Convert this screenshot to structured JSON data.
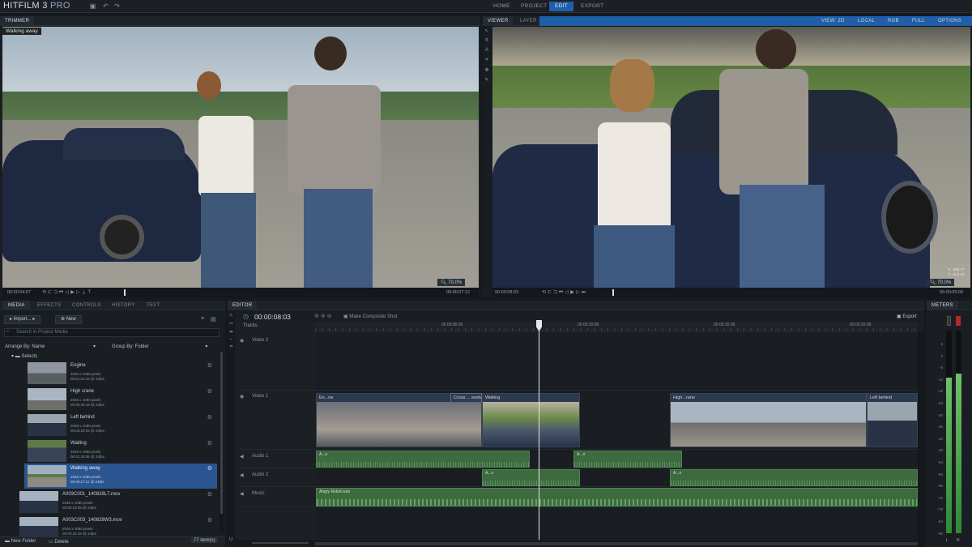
{
  "app": {
    "logo": "HITFILM 3",
    "logo_pro": "PRO"
  },
  "nav": {
    "tabs": [
      "HOME",
      "PROJECT",
      "EDIT",
      "EXPORT"
    ],
    "active": "EDIT"
  },
  "trimmer": {
    "title": "TRIMMER",
    "clip_label": "Walking away",
    "zoom": "70.0%",
    "timecode_in": "00:00:04:07",
    "timecode_out": "00:00:07:12"
  },
  "viewer": {
    "tabs": [
      "VIEWER",
      "LAYER"
    ],
    "options": [
      "VIEW: 2D",
      "LOCAL",
      "RGB",
      "FULL",
      "OPTIONS"
    ],
    "zoom": "70.0%",
    "timecode_in": "00:00:08:03",
    "timecode_out": "00:00:05:00",
    "coord_x": "X: -492.77",
    "coord_y": "Y: -341.93"
  },
  "media_panel": {
    "tabs": [
      "MEDIA",
      "EFFECTS",
      "CONTROLS",
      "HISTORY",
      "TEXT"
    ],
    "import_label": "Import...",
    "new_label": "New",
    "search_placeholder": "Search in Project Media",
    "arrange_label": "Arrange By: Name",
    "group_label": "Group By: Folder",
    "folder_name": "Selects",
    "items": [
      {
        "name": "Engine",
        "size": "2048 x 1080 pixels",
        "dur": "00:01:01:23 @ 24fps"
      },
      {
        "name": "High crane",
        "size": "2048 x 1080 pixels",
        "dur": "00:00:33:18 @ 24fps"
      },
      {
        "name": "Left behind",
        "size": "2048 x 1080 pixels",
        "dur": "00:00:29:05 @ 24fps"
      },
      {
        "name": "Waiting",
        "size": "2048 x 1080 pixels",
        "dur": "00:01:33:06 @ 24fps"
      },
      {
        "name": "Walking away",
        "size": "2048 x 1080 pixels",
        "dur": "00:00:17:11 @ 24fps"
      },
      {
        "name": "A003C001_140828L7.mov",
        "size": "2048 x 1080 pixels",
        "dur": "00:00:19:08 @ 24fps"
      },
      {
        "name": "A003C003_140828W3.mov",
        "size": "2048 x 1080 pixels",
        "dur": "00:00:18:19 @ 24fps"
      }
    ],
    "selected_item": "Walking away",
    "new_folder_label": "New Folder",
    "delete_label": "Delete",
    "item_count": "77 item(s)"
  },
  "editor": {
    "title": "EDITOR",
    "timecode": "00:00:08:03",
    "composite_label": "Make Composite Shot",
    "export_label": "Export",
    "tracks_label": "Tracks",
    "ruler": [
      "00:00:05:00",
      "00:00:10:00",
      "00:00:15:00",
      "00:00:20:00"
    ],
    "tracks": [
      "Video 2",
      "Video 1",
      "Audio 1",
      "Audio 2",
      "Music"
    ],
    "video_clips": [
      "En...ne",
      "Cross ... ssolve",
      "Waiting",
      "High...rane",
      "Left behind"
    ],
    "audio_clips": [
      "A...o",
      "A...o",
      "A...o",
      "A...o"
    ],
    "music_clip": "Angry Robot.wav"
  },
  "meters": {
    "title": "METERS",
    "db_labels": [
      "6",
      "0",
      "-6",
      "-12",
      "-18",
      "-24",
      "-30",
      "-36",
      "-42",
      "-48",
      "-54",
      "-60",
      "-66",
      "-72",
      "-78",
      "-84",
      "-90"
    ],
    "channels": [
      "L",
      "R"
    ],
    "levels": [
      0.77,
      0.79
    ]
  }
}
